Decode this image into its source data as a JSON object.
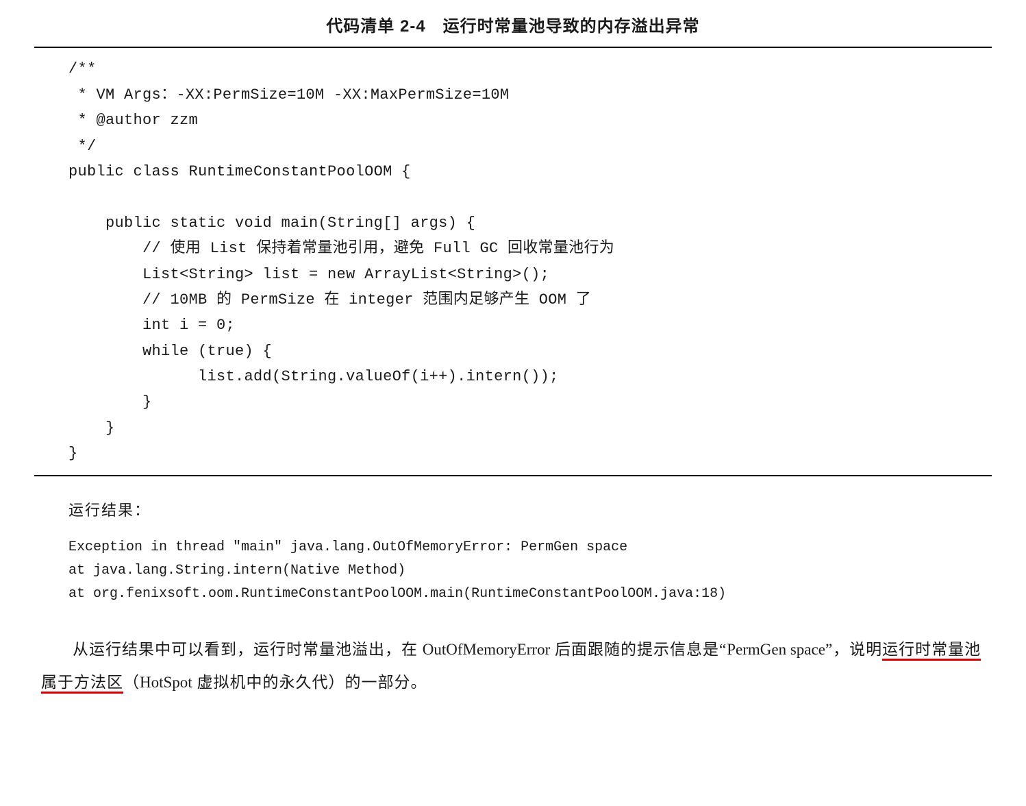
{
  "title": "代码清单 2-4　运行时常量池导致的内存溢出异常",
  "code": {
    "l1": "/**",
    "l2": " * VM Args：-XX:PermSize=10M -XX:MaxPermSize=10M",
    "l3": " * @author zzm",
    "l4": " */",
    "l5": "public class RuntimeConstantPoolOOM {",
    "l6": "",
    "l7": "    public static void main(String[] args) {",
    "l8": "        // 使用 List 保持着常量池引用，避免 Full GC 回收常量池行为",
    "l9": "        List<String> list = new ArrayList<String>();",
    "l10": "        // 10MB 的 PermSize 在 integer 范围内足够产生 OOM 了",
    "l11": "        int i = 0;",
    "l12": "        while (true) {",
    "l13": "              list.add(String.valueOf(i++).intern());",
    "l14": "        }",
    "l15": "    }",
    "l16": "}"
  },
  "result_label": "运行结果：",
  "result": {
    "l1": "Exception in thread \"main\" java.lang.OutOfMemoryError: PermGen space",
    "l2": "at java.lang.String.intern(Native Method)",
    "l3": "at org.fenixsoft.oom.RuntimeConstantPoolOOM.main(RuntimeConstantPoolOOM.java:18)"
  },
  "para": {
    "p1": "从运行结果中可以看到，运行时常量池溢出，在 ",
    "p2": "OutOfMemoryError",
    "p3": " 后面跟随的提示信息是“",
    "p4": "PermGen space",
    "p5": "”，说明",
    "p6": "运行时常量池属于方法区",
    "p7": "（",
    "p8": "HotSpot",
    "p9": " 虚拟机中的永久代）的一部分。"
  }
}
